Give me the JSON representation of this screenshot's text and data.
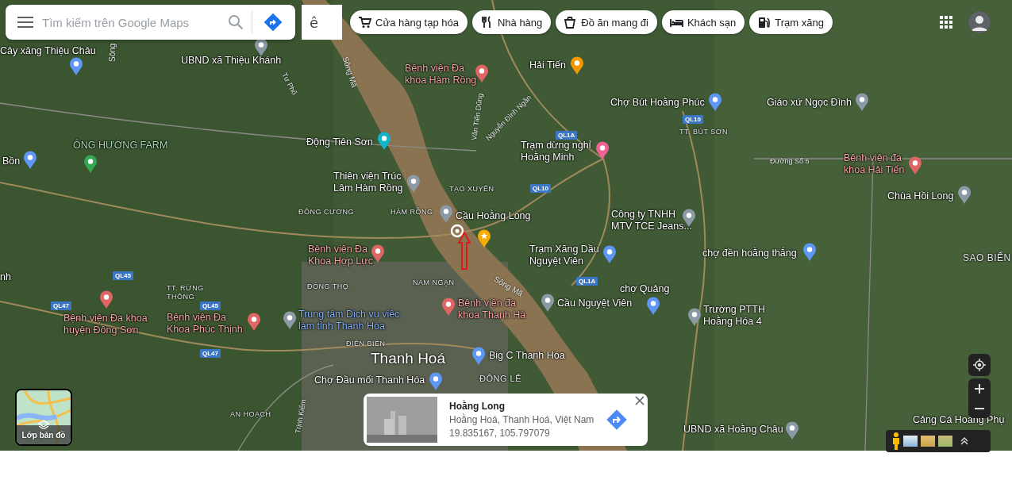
{
  "search": {
    "placeholder": "Tìm kiếm trên Google Maps"
  },
  "input_tool": {
    "label": "ê"
  },
  "category_chips": [
    {
      "label": "Cửa hàng tạp hóa",
      "kind": "grocery"
    },
    {
      "label": "Nhà hàng",
      "kind": "restaurant"
    },
    {
      "label": "Đồ ăn mang đi",
      "kind": "takeout"
    },
    {
      "label": "Khách sạn",
      "kind": "hotel"
    },
    {
      "label": "Trạm xăng",
      "kind": "gas"
    }
  ],
  "map_labels": [
    {
      "text": "Cây xăng Thiệu Châu",
      "kind": "fuel"
    },
    {
      "text": "UBND xã Thiệu Khánh",
      "kind": "government"
    },
    {
      "text": "Bệnh viện Đa\nkhoa Hàm Rồng",
      "kind": "hospital"
    },
    {
      "text": "Hải Tiến",
      "kind": "food"
    },
    {
      "text": "Chợ Bút Hoằng Phúc",
      "kind": "shopping"
    },
    {
      "text": "Giáo xứ Ngọc Đình",
      "kind": "church"
    },
    {
      "text": "ÔNG HƯỚNG FARM",
      "kind": "farm"
    },
    {
      "text": "Động Tiên Sơn",
      "kind": "attraction"
    },
    {
      "text": "Bồn",
      "kind": "shopping"
    },
    {
      "text": "Trạm dừng nghỉ\nHoằng Minh",
      "kind": "hotel"
    },
    {
      "text": "Thiên viện Trúc\nLâm Hàm Rồng",
      "kind": "temple"
    },
    {
      "text": "Bệnh viện đa\nkhoa Hải Tiến",
      "kind": "hospital"
    },
    {
      "text": "Chùa Hồi Long",
      "kind": "temple"
    },
    {
      "text": "Cầu Hoằng Long",
      "kind": "bridge"
    },
    {
      "text": "Công ty TNHH\nMTV TCE Jeans...",
      "kind": "generic"
    },
    {
      "text": "Bệnh viện Đa\nKhoa Hợp Lực",
      "kind": "hospital"
    },
    {
      "text": "Trạm Xăng Dầu\nNguyệt Viên",
      "kind": "fuel"
    },
    {
      "text": "chợ đền hoằng thắng",
      "kind": "shopping"
    },
    {
      "text": "nh",
      "kind": "plain"
    },
    {
      "text": "chợ Quảng",
      "kind": "shopping"
    },
    {
      "text": "Bệnh viện Đa khoa\nhuyện Đông Sơn",
      "kind": "hospital"
    },
    {
      "text": "Bệnh viện Đa\nKhoa Phúc Thịnh",
      "kind": "hospital"
    },
    {
      "text": "Trung tâm Dịch vụ việc\nlàm tỉnh Thanh Hóa",
      "kind": "office"
    },
    {
      "text": "Bệnh viện đa\nkhoa Thanh Hà",
      "kind": "hospital"
    },
    {
      "text": "Cầu Nguyệt Viên",
      "kind": "bridge"
    },
    {
      "text": "Trường PTTH\nHoằng Hóa 4",
      "kind": "school"
    },
    {
      "text": "Big C Thanh Hóa",
      "kind": "shopping"
    },
    {
      "text": "Chợ Đầu mối Thanh Hóa",
      "kind": "shopping"
    },
    {
      "text": "UBND xã Hoằng Châu",
      "kind": "government"
    },
    {
      "text": "Cảng Cá Hoằng Phụ",
      "kind": "plain"
    }
  ],
  "city_label": "Thanh Hoá",
  "area_labels": [
    "TT. BÚT SƠN",
    "TẠO XUYÊN",
    "ĐÔNG CƯƠNG",
    "HÀM RỒNG",
    "SAO BIỂN",
    "TT. RỪNG\nTHÔNG",
    "ĐÔNG THỌ",
    "NAM NGẠN",
    "ĐIỆN BIÊN",
    "ĐÔNG LỄ",
    "AN HOẠCH"
  ],
  "road_labels": [
    "Đường Số 6",
    "Sông Mã",
    "Tư Phố",
    "Văn Tiến Dũng",
    "Nguyễn Đình Ngần",
    "Sông Mã",
    "Trịnh Kiểm",
    "Sông"
  ],
  "route_shields": [
    "QL1A",
    "QL10",
    "QL10",
    "QL45",
    "QL45",
    "QL47",
    "QL47",
    "QL1A"
  ],
  "place_card": {
    "title": "Hoằng Long",
    "address": "Hoằng Hoá, Thanh Hoá, Việt Nam",
    "coordinates": "19.835167, 105.797079"
  },
  "layers_button": {
    "label": "Lớp bản đồ"
  }
}
